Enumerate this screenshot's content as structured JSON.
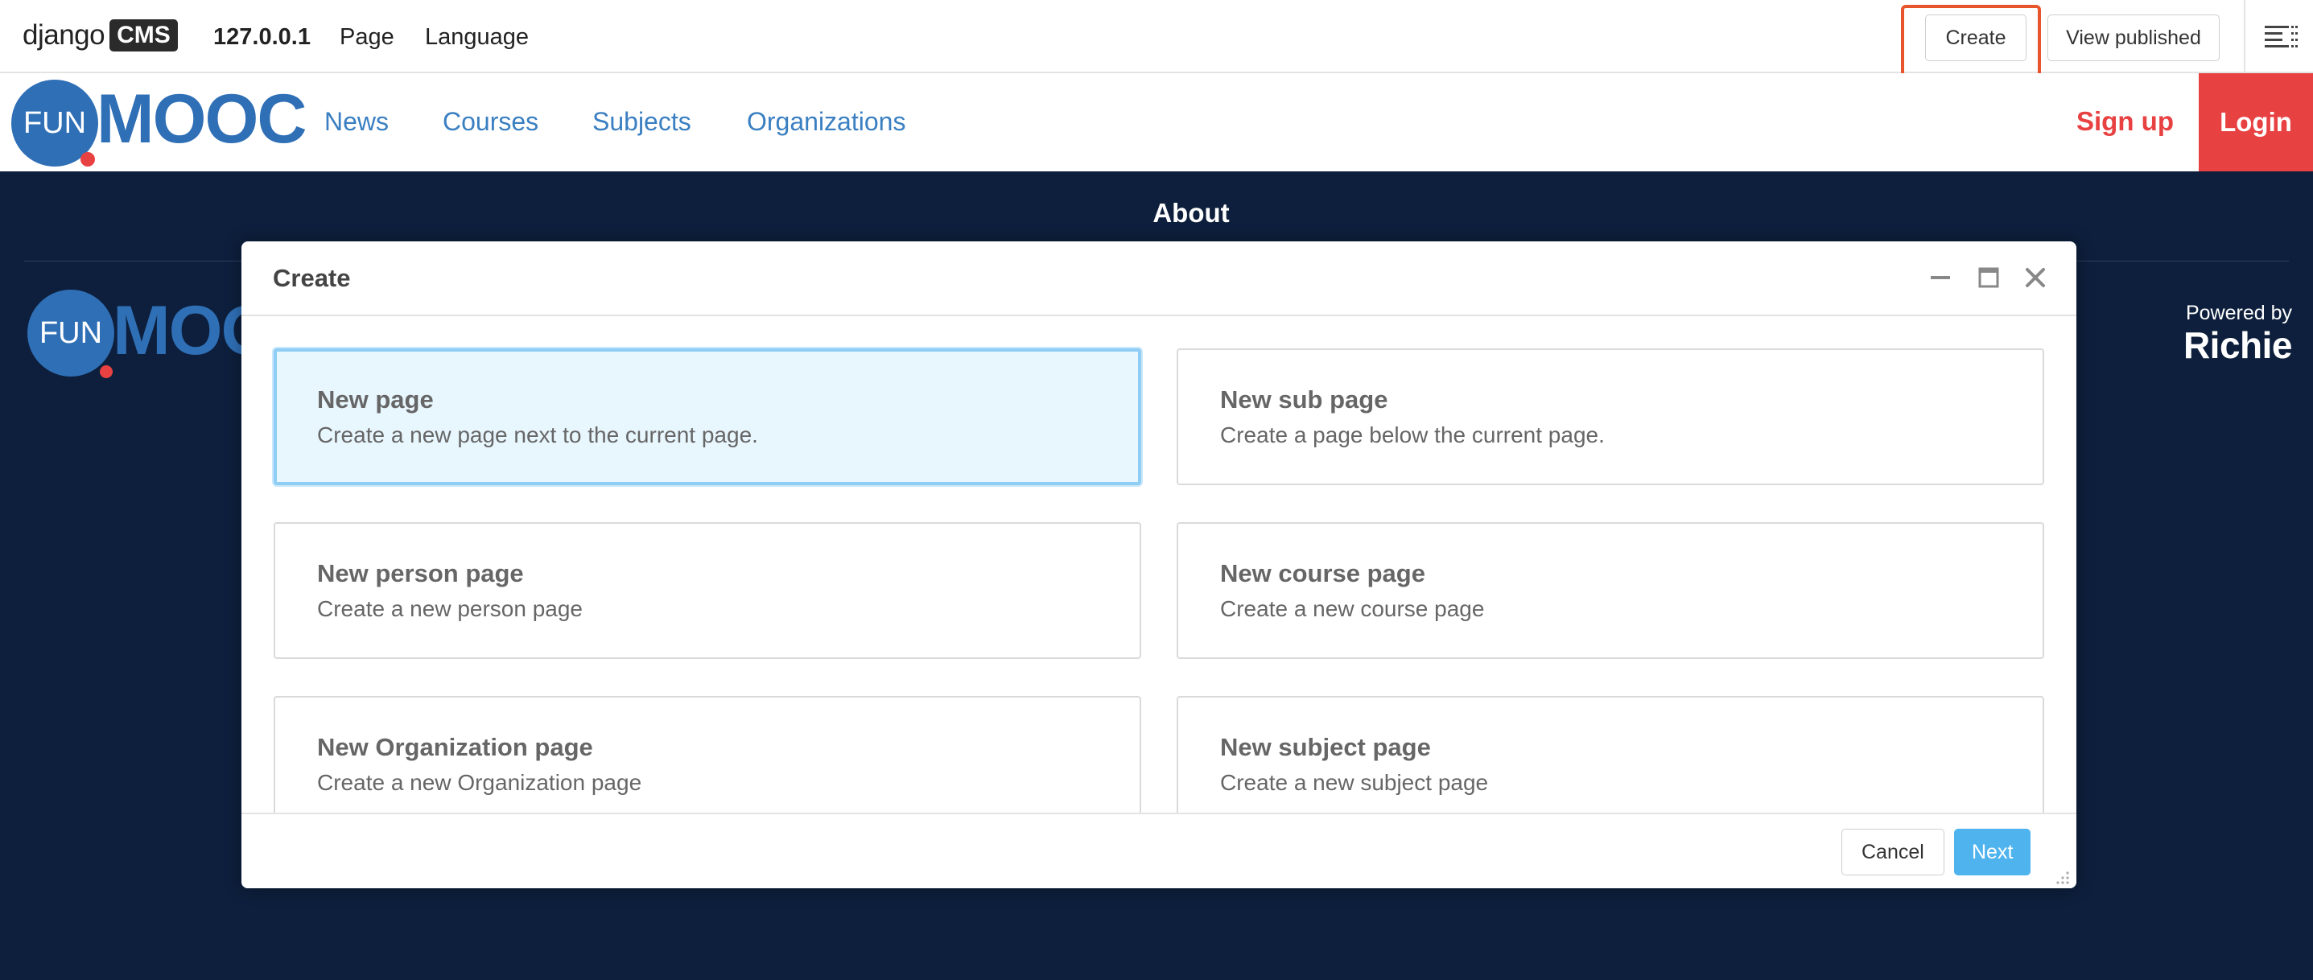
{
  "toolbar": {
    "logo_text": "django",
    "logo_badge": "CMS",
    "host": "127.0.0.1",
    "page_menu": "Page",
    "language_menu": "Language",
    "create_button": "Create",
    "view_published_button": "View published",
    "menu_icon": "sideframe-menu-icon",
    "highlight_color": "#e8542b"
  },
  "site_header": {
    "logo": {
      "circle_text": "FUN",
      "wordmark": "MOOC"
    },
    "nav": [
      {
        "label": "News"
      },
      {
        "label": "Courses"
      },
      {
        "label": "Subjects"
      },
      {
        "label": "Organizations"
      }
    ],
    "signup": "Sign up",
    "login": "Login",
    "brand_color": "#2f6fb6",
    "accent_color": "#e84142"
  },
  "page": {
    "title": "About",
    "footer_logo": {
      "circle_text": "FUN",
      "wordmark": "MOOC"
    },
    "powered_by": "Powered by",
    "powered_by_brand": "Richie",
    "background_color": "#0d1f3c"
  },
  "modal": {
    "title": "Create",
    "controls": [
      "minimize-icon",
      "maximize-icon",
      "close-icon"
    ],
    "options": [
      {
        "title": "New page",
        "description": "Create a new page next to the current page.",
        "selected": true
      },
      {
        "title": "New sub page",
        "description": "Create a page below the current page.",
        "selected": false
      },
      {
        "title": "New person page",
        "description": "Create a new person page",
        "selected": false
      },
      {
        "title": "New course page",
        "description": "Create a new course page",
        "selected": false
      },
      {
        "title": "New Organization page",
        "description": "Create a new Organization page",
        "selected": false
      },
      {
        "title": "New subject page",
        "description": "Create a new subject page",
        "selected": false
      }
    ],
    "cancel_button": "Cancel",
    "next_button": "Next",
    "next_color": "#4fb3ee"
  }
}
